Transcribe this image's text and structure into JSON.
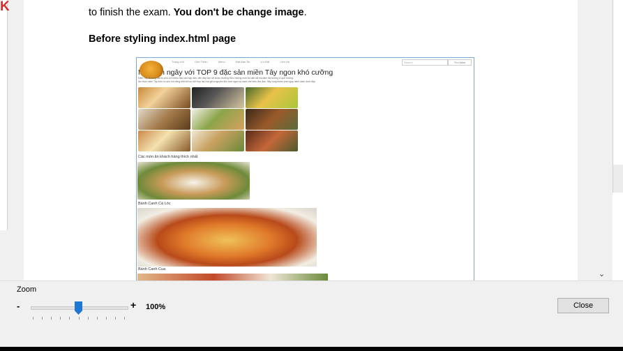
{
  "document": {
    "line1_prefix": "to finish the exam. ",
    "line1_bold": "You don't be change image",
    "line1_suffix": ".",
    "heading": "Before styling index.html page"
  },
  "embedded_screenshot": {
    "nav_items": [
      "Trang chủ",
      "Giới Thiệu",
      "Menu",
      "Đặt Bàn Ăn",
      "Ưu Đãi",
      "Liên Hệ"
    ],
    "search_placeholder": "Search",
    "search_button": "Tìm kiếm",
    "title": "Mê mẩn ngây với TOP 9 đặc sản miền Tây ngon khó cưỡng",
    "paragraph1": "Miền Tây là vùng đất trù phú với nhiều đặc sản hấp dẫn, đến đây bạn sẽ được thưởng thức những món ăn dân dã mà đậm đà hương vị quê hương.",
    "paragraph2": "Ẩm thực miền Tây luôn có sức hút riêng biệt bởi sự kết hợp hài hòa giữa nguyên liệu tươi ngon và cách chế biến độc đáo, hãy cùng khám phá ngay danh sách dưới đây.",
    "caption_favorites": "Các món ăn khách hàng thích nhất",
    "caption_1": "Bánh Canh Cá Lóc",
    "caption_2": "Bánh Canh Cua"
  },
  "zoom": {
    "label": "Zoom",
    "minus": "-",
    "plus": "+",
    "percent": "100%",
    "level_fraction": 0.5
  },
  "buttons": {
    "close": "Close"
  },
  "colors": {
    "slider_thumb": "#1e77d3",
    "logo_red": "#d62b2b",
    "screenshot_border": "#7aa7d4"
  },
  "icons": {
    "scroll_down": "chevron-down-icon",
    "logo": "k-logo-icon"
  }
}
